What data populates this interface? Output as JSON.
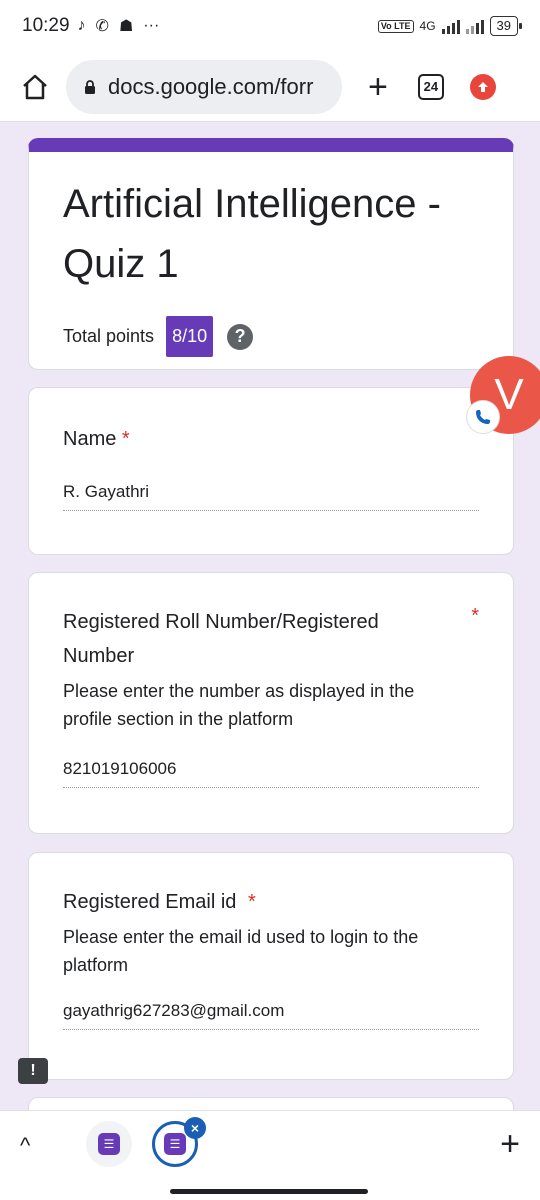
{
  "status_bar": {
    "time": "10:29",
    "left_icons": [
      "tiktok-icon",
      "phone-icon",
      "snapchat-icon",
      "more-icon"
    ],
    "network": "4G",
    "volte": "Vo LTE",
    "battery": "39"
  },
  "browser": {
    "url": "docs.google.com/forr",
    "tab_count": "24"
  },
  "form": {
    "title": "Artificial Intelligence - Quiz 1",
    "points_label": "Total points",
    "points_value": "8/10",
    "help": "?",
    "required_mark": "*",
    "questions": [
      {
        "label": "Name",
        "description": "",
        "answer": "R. Gayathri"
      },
      {
        "label": "Registered Roll Number/Registered Number",
        "description": "Please enter the number as displayed in the profile section in the platform",
        "answer": "821019106006"
      },
      {
        "label": "Registered Email id",
        "description": "Please enter the email id used to login to the platform",
        "answer": "gayathrig627283@gmail.com"
      }
    ]
  },
  "overlay": {
    "letter": "V"
  },
  "feedback_icon": "!",
  "bottom_bar": {
    "chevron": "^",
    "plus": "+",
    "close": "×"
  },
  "colors": {
    "accent": "#673ab7",
    "background": "#ede7f6",
    "required": "#d93025"
  }
}
